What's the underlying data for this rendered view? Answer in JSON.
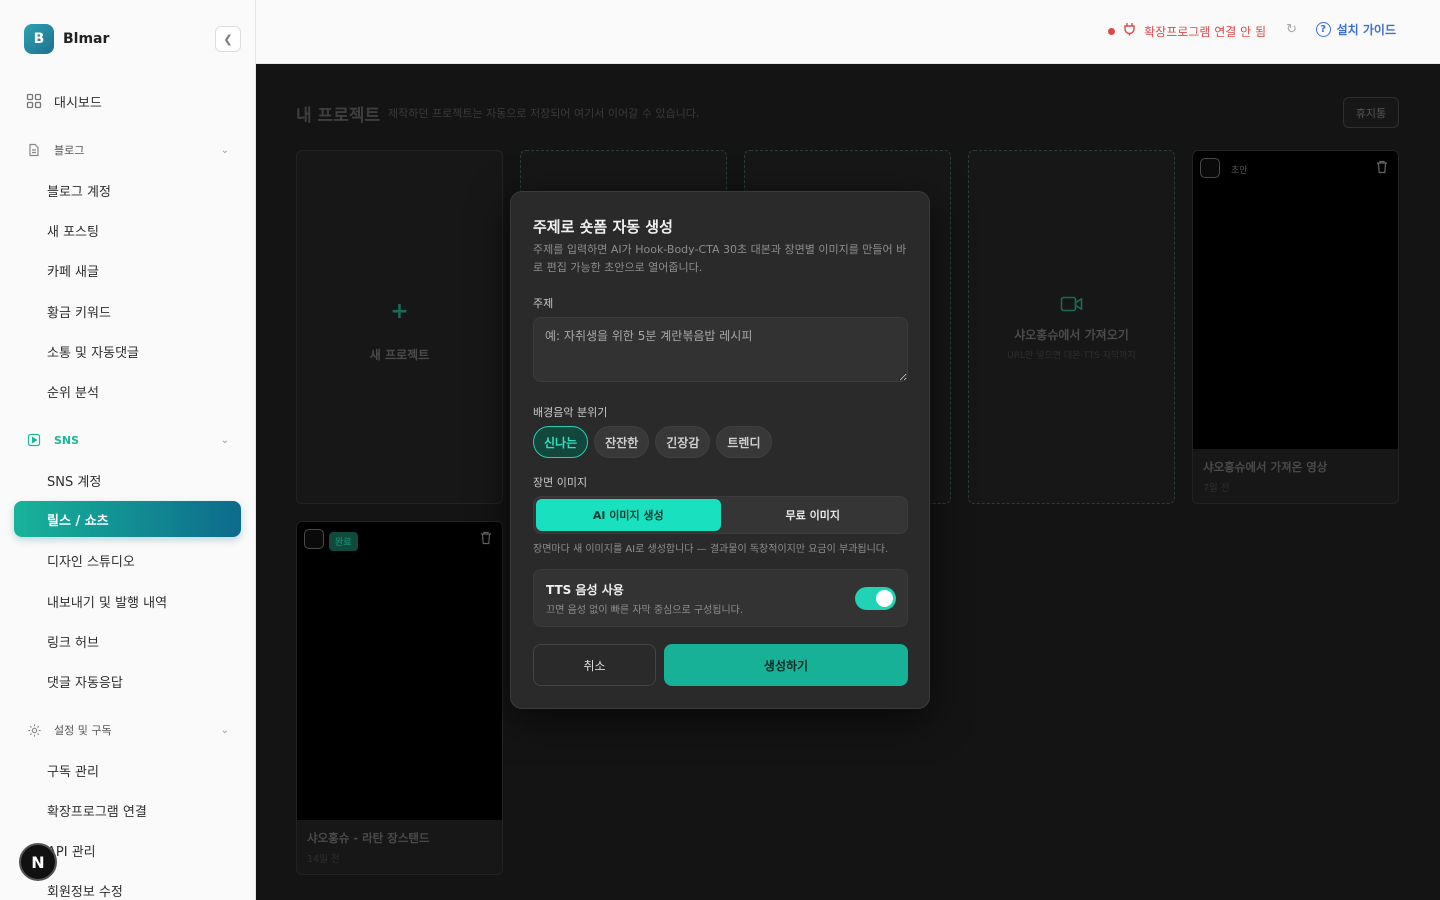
{
  "brand": {
    "logo_letter": "B",
    "name": "Blmar"
  },
  "sidebar": {
    "dashboard": "대시보드",
    "blog_section": "블로그",
    "blog_items": [
      "블로그 계정",
      "새 포스팅",
      "카페 새글",
      "황금 키워드",
      "소통 및 자동댓글",
      "순위 분석"
    ],
    "sns_section": "SNS",
    "sns_items": [
      "SNS 계정",
      "릴스 / 쇼츠",
      "디자인 스튜디오",
      "내보내기 및 발행 내역",
      "링크 허브",
      "댓글 자동응답"
    ],
    "settings_section": "설정 및 구독",
    "settings_items": [
      "구독 관리",
      "확장프로그램 연결",
      "API 관리",
      "회원정보 수정"
    ],
    "active_item": "릴스 / 쇼츠",
    "n_badge": "N"
  },
  "topbar": {
    "extension_status": "확장프로그램 연결 안 됨",
    "install_guide": "설치 가이드"
  },
  "main": {
    "title": "내 프로젝트",
    "subtitle": "제작하던 프로젝트는 자동으로 저장되어 여기서 이어갈 수 있습니다.",
    "trash_button": "휴지통",
    "new_project_label": "새 프로젝트",
    "import_card": {
      "title": "샤오홍슈에서 가져오기",
      "subtitle": "URL만 넣으면 대본·TTS·자막까지"
    },
    "projects": [
      {
        "status": "초안",
        "title": "샤오홍슈에서 가져온 영상",
        "time": "7일 전"
      },
      {
        "status": "완료",
        "title": "샤오홍슈 - 라탄 장스탠드",
        "time": "14일 전"
      }
    ]
  },
  "modal": {
    "title": "주제로 숏폼 자동 생성",
    "description": "주제를 입력하면 AI가 Hook-Body-CTA 30초 대본과 장면별 이미지를 만들어 바로 편집 가능한 초안으로 열어줍니다.",
    "topic_label": "주제",
    "topic_placeholder": "예: 자취생을 위한 5분 계란볶음밥 레시피",
    "bgm_label": "배경음악 분위기",
    "bgm_options": [
      "신나는",
      "잔잔한",
      "긴장감",
      "트렌디"
    ],
    "bgm_selected": "신나는",
    "scene_label": "장면 이미지",
    "scene_options": [
      "AI 이미지 생성",
      "무료 이미지"
    ],
    "scene_selected": "AI 이미지 생성",
    "scene_note": "장면마다 새 이미지를 AI로 생성합니다 — 결과물이 독창적이지만 요금이 부과됩니다.",
    "tts_title": "TTS 음성 사용",
    "tts_subtitle": "끄면 음성 없이 빠른 자막 중심으로 구성됩니다.",
    "tts_enabled": true,
    "cancel_button": "취소",
    "create_button": "생성하기"
  },
  "colors": {
    "accent": "#19e0bf",
    "accent_dark": "#16b196",
    "error": "#e04848",
    "link": "#3d6fd6"
  }
}
